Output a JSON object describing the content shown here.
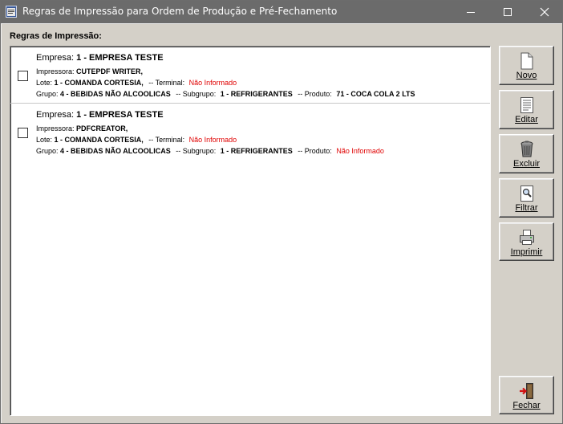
{
  "window": {
    "title": "Regras de Impressão para Ordem de Produção e Pré-Fechamento"
  },
  "section_label": "Regras de Impressão:",
  "colors": {
    "titlebar": "#6b6b6b",
    "panel": "#d4d0c8",
    "not_informed": "#e00000"
  },
  "rules": [
    {
      "empresa_label": "Empresa:",
      "empresa": "1 - EMPRESA TESTE",
      "impressora_label": "Impressora:",
      "impressora": "CUTEPDF WRITER",
      "lote_label": "Lote:",
      "lote": "1 - COMANDA CORTESIA",
      "terminal_label": "-- Terminal:",
      "terminal": "Não Informado",
      "grupo_label": "Grupo:",
      "grupo": "4 - BEBIDAS NÃO ALCOOLICAS",
      "subgrupo_label": "-- Subgrupo:",
      "subgrupo": "1 - REFRIGERANTES",
      "produto_label": "-- Produto:",
      "produto": "71 - COCA COLA 2 LTS",
      "checked": false
    },
    {
      "empresa_label": "Empresa:",
      "empresa": "1 - EMPRESA TESTE",
      "impressora_label": "Impressora:",
      "impressora": "PDFCREATOR",
      "lote_label": "Lote:",
      "lote": "1 - COMANDA CORTESIA",
      "terminal_label": "-- Terminal:",
      "terminal": "Não Informado",
      "grupo_label": "Grupo:",
      "grupo": "4 - BEBIDAS NÃO ALCOOLICAS",
      "subgrupo_label": "-- Subgrupo:",
      "subgrupo": "1 - REFRIGERANTES",
      "produto_label": "-- Produto:",
      "produto": "Não Informado",
      "checked": false
    }
  ],
  "buttons": {
    "novo": "Novo",
    "editar": "Editar",
    "excluir": "Excluir",
    "filtrar": "Filtrar",
    "imprimir": "Imprimir",
    "fechar": "Fechar"
  },
  "icons": {
    "app": "app-window-icon",
    "novo": "new-document-icon",
    "editar": "edit-document-icon",
    "excluir": "trash-can-icon",
    "filtrar": "magnifier-document-icon",
    "imprimir": "printer-icon",
    "fechar": "exit-door-icon"
  }
}
